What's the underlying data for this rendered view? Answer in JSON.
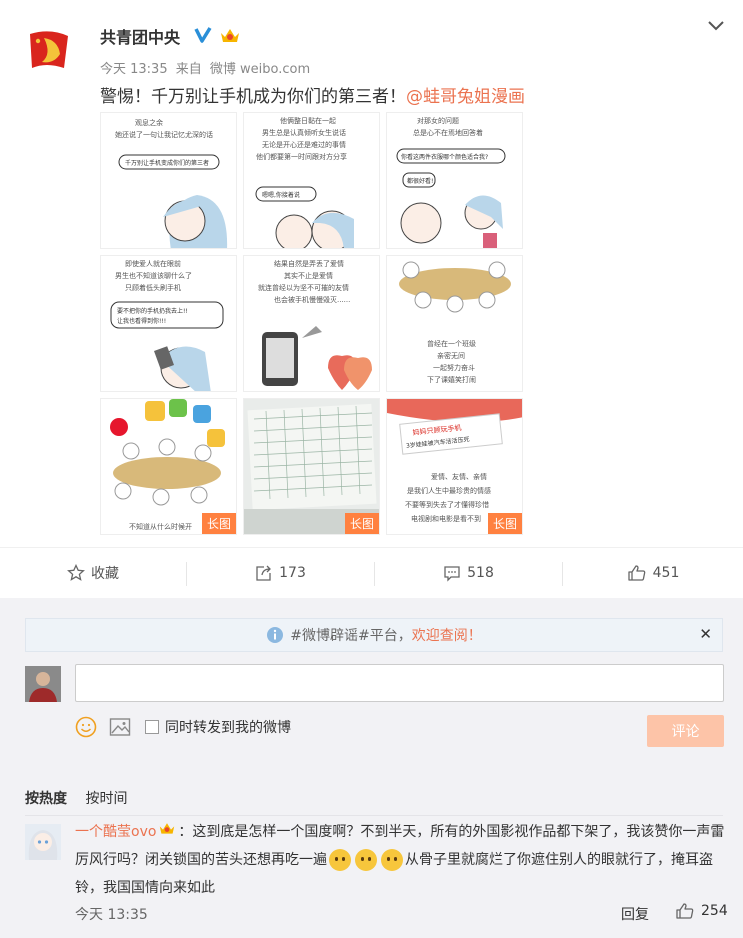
{
  "post": {
    "username": "共青团中央",
    "time": "今天 13:35",
    "source_prefix": "来自",
    "source": "微博 weibo.com",
    "text": "警惕！千万别让手机成为你们的第三者！",
    "mention": "@蛙哥兔姐漫画",
    "images": [
      {
        "name": "comic-1",
        "caption": "观息之余\n她还说了一句让我记忆尤深的话",
        "bubble": "千万别让手机变成你们的第三者"
      },
      {
        "name": "comic-2",
        "caption": "他俩整日黏在一起\n男生总是认真倾听女生说话\n无论是开心还是难过的事情\n他们都要第一时间跟对方分享",
        "bubble": "嗯嗯,你接着说"
      },
      {
        "name": "comic-3",
        "caption": "对那女的问题\n总是心不在焉地回答着",
        "bubble": "你看这两件衣服哪个颜色适合我?"
      },
      {
        "name": "comic-4",
        "caption": "即使爱人就在眼前\n男生也不知道该聊什么了\n只顾着低头刷手机",
        "bubble": "要不把你的手机扔我去上!!"
      },
      {
        "name": "comic-5",
        "caption": "结果自然是弄丢了爱情\n其实不止是爱情\n就连曾经以为坚不可摧的友情\n也会被手机慢慢毁灭......",
        "bubble": ""
      },
      {
        "name": "comic-6",
        "caption": "曾经在一个班级\n亲密无间\n一起努力奋斗\n下了课嬉笑打闹",
        "bubble": ""
      },
      {
        "name": "comic-7",
        "caption": "不知道从什么时候开",
        "bubble": "",
        "tag": "长图"
      },
      {
        "name": "comic-8",
        "caption": "",
        "bubble": "",
        "tag": "长图"
      },
      {
        "name": "comic-9",
        "caption": "爱情、友情、亲情\n是我们人生中最珍贵的情感\n不要等到失去了才懂得珍惜\n电视剧和电影是看不到",
        "bubble": "妈妈只顾玩手机\n3岁娃娃被汽车活活压死",
        "tag": "长图"
      }
    ]
  },
  "actions": {
    "favorite": "收藏",
    "repost": "173",
    "comments": "518",
    "likes": "451"
  },
  "comment_area": {
    "notice_prefix": "#微博辟谣#平台，",
    "notice_accent": "欢迎查阅！",
    "notice_close": "✕",
    "sync_label": "同时转发到我的微博",
    "submit_label": "评论",
    "sort_hot": "按热度",
    "sort_time": "按时间"
  },
  "comment": {
    "user": "一个酷莹ovo",
    "text_part1": "：这到底是怎样一个国度啊？不到半天，所有的外国影视作品都下架了，我该赞你一声雷厉风行吗？闭关锁国的苦头还想再吃一遍",
    "text_part2": "从骨子里就腐烂了你遮住别人的眼就行了，掩耳盗铃，我国国情向来如此",
    "time": "今天 13:35",
    "reply": "回复",
    "likes": "254"
  },
  "colors": {
    "accent": "#eb7350",
    "tag": "#ff8140",
    "verify": "#2a8fd8",
    "submit_disabled": "#fdc4a8"
  }
}
